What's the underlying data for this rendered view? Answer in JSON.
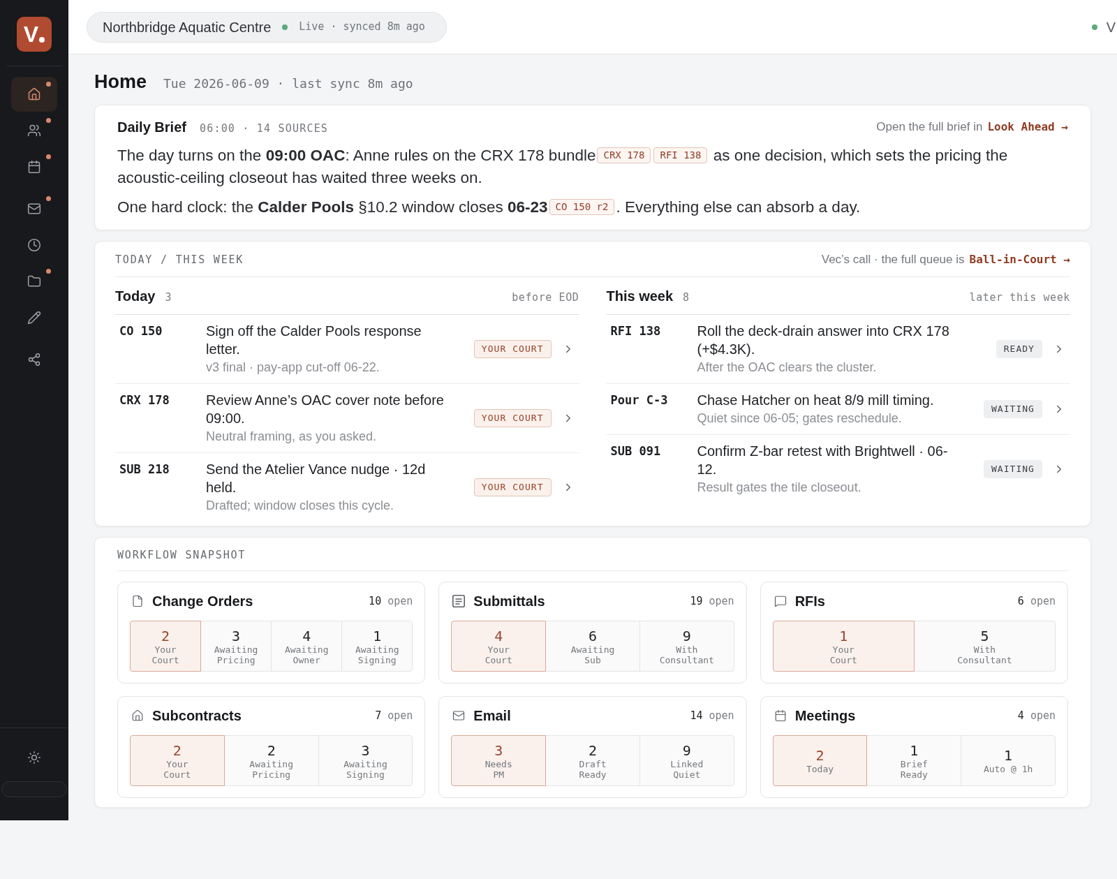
{
  "sidebar": {
    "logo": "V",
    "groups": [
      {
        "items": [
          {
            "kind": "home",
            "selected": true,
            "alert": true
          },
          {
            "kind": "people",
            "selected": false,
            "alert": true
          },
          {
            "kind": "calendar",
            "selected": false,
            "alert": true
          }
        ]
      },
      {
        "items": [
          {
            "kind": "mail",
            "selected": false,
            "alert": true
          },
          {
            "kind": "clock",
            "selected": false,
            "alert": false
          },
          {
            "kind": "folder",
            "selected": false,
            "alert": true
          },
          {
            "kind": "pencil",
            "selected": false,
            "alert": false
          }
        ]
      },
      {
        "items": [
          {
            "kind": "share",
            "selected": false,
            "alert": false
          }
        ]
      }
    ]
  },
  "header": {
    "project": "Northbridge Aquatic Centre",
    "sync_status": "Live · synced 8m ago",
    "presence": "V"
  },
  "page": {
    "title": "Home",
    "subtitle": "Tue 2026-06-09 · last sync 8m ago"
  },
  "daily_brief": {
    "title": "Daily Brief",
    "meta": "06:00 · 14 SOURCES",
    "link_lead": "Open the full brief in",
    "link": "Look Ahead →",
    "paragraphs": [
      {
        "segments": [
          {
            "kind": "text",
            "text": "The day turns on the **09:00 OAC**: Anne rules on the CRX 178 bundle"
          },
          {
            "kind": "ref",
            "text": "CRX 178"
          },
          {
            "kind": "ref",
            "text": "RFI 138"
          },
          {
            "kind": "text",
            "text": " as one decision, which sets the pricing the acoustic-ceiling closeout has waited three weeks on."
          }
        ]
      },
      {
        "segments": [
          {
            "kind": "text",
            "text": "One hard clock: the **Calder Pools** §10.2 window closes **06-23**"
          },
          {
            "kind": "ref",
            "text": "CO 150 r2"
          },
          {
            "kind": "text",
            "text": ". Everything else can absorb a day."
          }
        ]
      }
    ]
  },
  "agenda": {
    "title": "TODAY / THIS WEEK",
    "note": "Vec’s call · the full queue is",
    "link": "Ball-in-Court →",
    "columns": [
      {
        "title": "Today",
        "count": "3",
        "hint": "before EOD",
        "items": [
          {
            "ref": "CO 150",
            "title": "Sign off the Calder Pools response letter.",
            "detail": "v3 final · pay-app cut-off 06-22.",
            "status": {
              "kind": "yours",
              "label": "YOUR COURT"
            }
          },
          {
            "ref": "CRX 178",
            "title": "Review Anne’s OAC cover note before 09:00.",
            "detail": "Neutral framing, as you asked.",
            "status": {
              "kind": "yours",
              "label": "YOUR COURT"
            }
          },
          {
            "ref": "SUB 218",
            "title": "Send the Atelier Vance nudge · 12d held.",
            "detail": "Drafted; window closes this cycle.",
            "status": {
              "kind": "yours",
              "label": "YOUR COURT"
            }
          }
        ]
      },
      {
        "title": "This week",
        "count": "8",
        "hint": "later this week",
        "items": [
          {
            "ref": "RFI 138",
            "title": "Roll the deck-drain answer into CRX 178 (+$4.3K).",
            "detail": "After the OAC clears the cluster.",
            "status": {
              "kind": "ready",
              "label": "READY"
            }
          },
          {
            "ref": "Pour C-3",
            "title": "Chase Hatcher on heat 8/9 mill timing.",
            "detail": "Quiet since 06-05; gates reschedule.",
            "status": {
              "kind": "waiting",
              "label": "WAITING"
            }
          },
          {
            "ref": "SUB 091",
            "title": "Confirm Z-bar retest with Brightwell · 06-12.",
            "detail": "Result gates the tile closeout.",
            "status": {
              "kind": "waiting",
              "label": "WAITING"
            }
          }
        ]
      }
    ]
  },
  "workflow": {
    "title": "WORKFLOW SNAPSHOT",
    "cards": [
      {
        "kind": "change_orders",
        "title": "Change Orders",
        "count": "10",
        "count_label": "open",
        "stats": [
          {
            "value": "2",
            "label": [
              "Your",
              "Court"
            ],
            "highlighted": true
          },
          {
            "value": "3",
            "label": [
              "Awaiting",
              "Pricing"
            ],
            "highlighted": false
          },
          {
            "value": "4",
            "label": [
              "Awaiting",
              "Owner"
            ],
            "highlighted": false
          },
          {
            "value": "1",
            "label": [
              "Awaiting",
              "Signing"
            ],
            "highlighted": false
          }
        ]
      },
      {
        "kind": "submittals",
        "title": "Submittals",
        "count": "19",
        "count_label": "open",
        "stats": [
          {
            "value": "4",
            "label": [
              "Your",
              "Court"
            ],
            "highlighted": true
          },
          {
            "value": "6",
            "label": [
              "Awaiting",
              "Sub"
            ],
            "highlighted": false
          },
          {
            "value": "9",
            "label": [
              "With",
              "Consultant"
            ],
            "highlighted": false
          }
        ]
      },
      {
        "kind": "rfis",
        "title": "RFIs",
        "count": "6",
        "count_label": "open",
        "stats": [
          {
            "value": "1",
            "label": [
              "Your",
              "Court"
            ],
            "highlighted": true
          },
          {
            "value": "5",
            "label": [
              "With",
              "Consultant"
            ],
            "highlighted": false
          }
        ]
      },
      {
        "kind": "subcontracts",
        "title": "Subcontracts",
        "count": "7",
        "count_label": "open",
        "stats": [
          {
            "value": "2",
            "label": [
              "Your",
              "Court"
            ],
            "highlighted": true
          },
          {
            "value": "2",
            "label": [
              "Awaiting",
              "Pricing"
            ],
            "highlighted": false
          },
          {
            "value": "3",
            "label": [
              "Awaiting",
              "Signing"
            ],
            "highlighted": false
          }
        ]
      },
      {
        "kind": "email",
        "title": "Email",
        "count": "14",
        "count_label": "open",
        "stats": [
          {
            "value": "3",
            "label": [
              "Needs",
              "PM"
            ],
            "highlighted": true
          },
          {
            "value": "2",
            "label": [
              "Draft",
              "Ready"
            ],
            "highlighted": false
          },
          {
            "value": "9",
            "label": [
              "Linked",
              "Quiet"
            ],
            "highlighted": false
          }
        ]
      },
      {
        "kind": "meetings",
        "title": "Meetings",
        "count": "4",
        "count_label": "open",
        "stats": [
          {
            "value": "2",
            "label": [
              "Today"
            ],
            "highlighted": true
          },
          {
            "value": "1",
            "label": [
              "Brief",
              "Ready"
            ],
            "highlighted": false
          },
          {
            "value": "1",
            "label": [
              "Auto @ 1h"
            ],
            "highlighted": false
          }
        ]
      }
    ]
  }
}
